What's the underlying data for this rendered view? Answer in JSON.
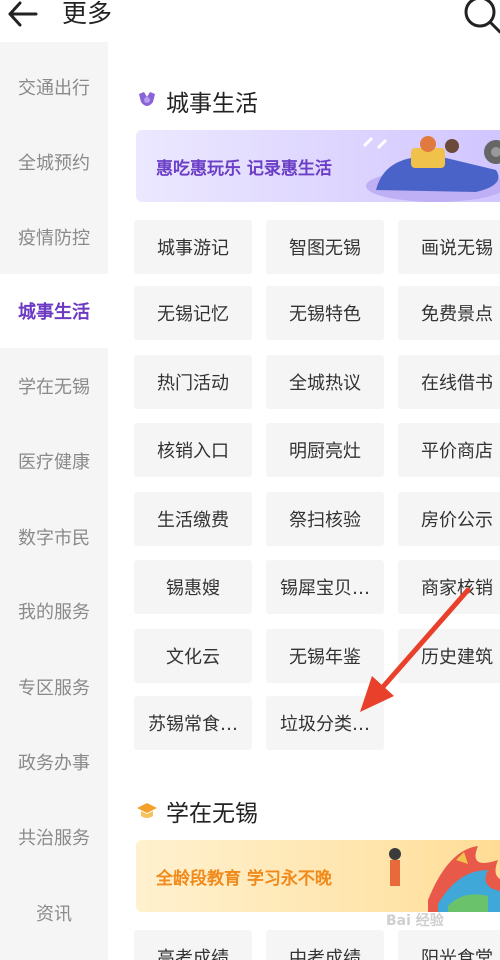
{
  "header": {
    "back_icon": "arrow-left-icon",
    "title": "更多",
    "search_icon": "search-icon"
  },
  "sidebar": {
    "items": [
      {
        "label": "交通出行"
      },
      {
        "label": "全城预约"
      },
      {
        "label": "疫情防控"
      },
      {
        "label": "城事生活",
        "active": true
      },
      {
        "label": "学在无锡"
      },
      {
        "label": "医疗健康"
      },
      {
        "label": "数字市民"
      },
      {
        "label": "我的服务"
      },
      {
        "label": "专区服务"
      },
      {
        "label": "政务办事"
      },
      {
        "label": "共治服务"
      },
      {
        "label": "资讯"
      }
    ]
  },
  "sections": [
    {
      "title": "城事生活",
      "icon": "flower-icon",
      "banner_text": "惠吃惠玩乐 记录惠生活",
      "items": [
        "城事游记",
        "智图无锡",
        "画说无锡",
        "无锡记忆",
        "无锡特色",
        "免费景点",
        "热门活动",
        "全城热议",
        "在线借书",
        "核销入口",
        "明厨亮灶",
        "平价商店",
        "生活缴费",
        "祭扫核验",
        "房价公示",
        "锡惠嫂",
        "锡犀宝贝…",
        "商家核销",
        "文化云",
        "无锡年鉴",
        "历史建筑",
        "苏锡常食…",
        "垃圾分类…"
      ]
    },
    {
      "title": "学在无锡",
      "icon": "graduation-cap-icon",
      "banner_text": "全龄段教育 学习永不晚",
      "items": [
        "高考成绩",
        "中考成绩",
        "阳光食堂"
      ]
    }
  ],
  "colors": {
    "accent": "#6c3ac2",
    "sidebar_bg": "#f5f5f5",
    "tile_bg": "#f5f5f5",
    "arrow": "#e8402a"
  },
  "watermark": "Bai 经验"
}
